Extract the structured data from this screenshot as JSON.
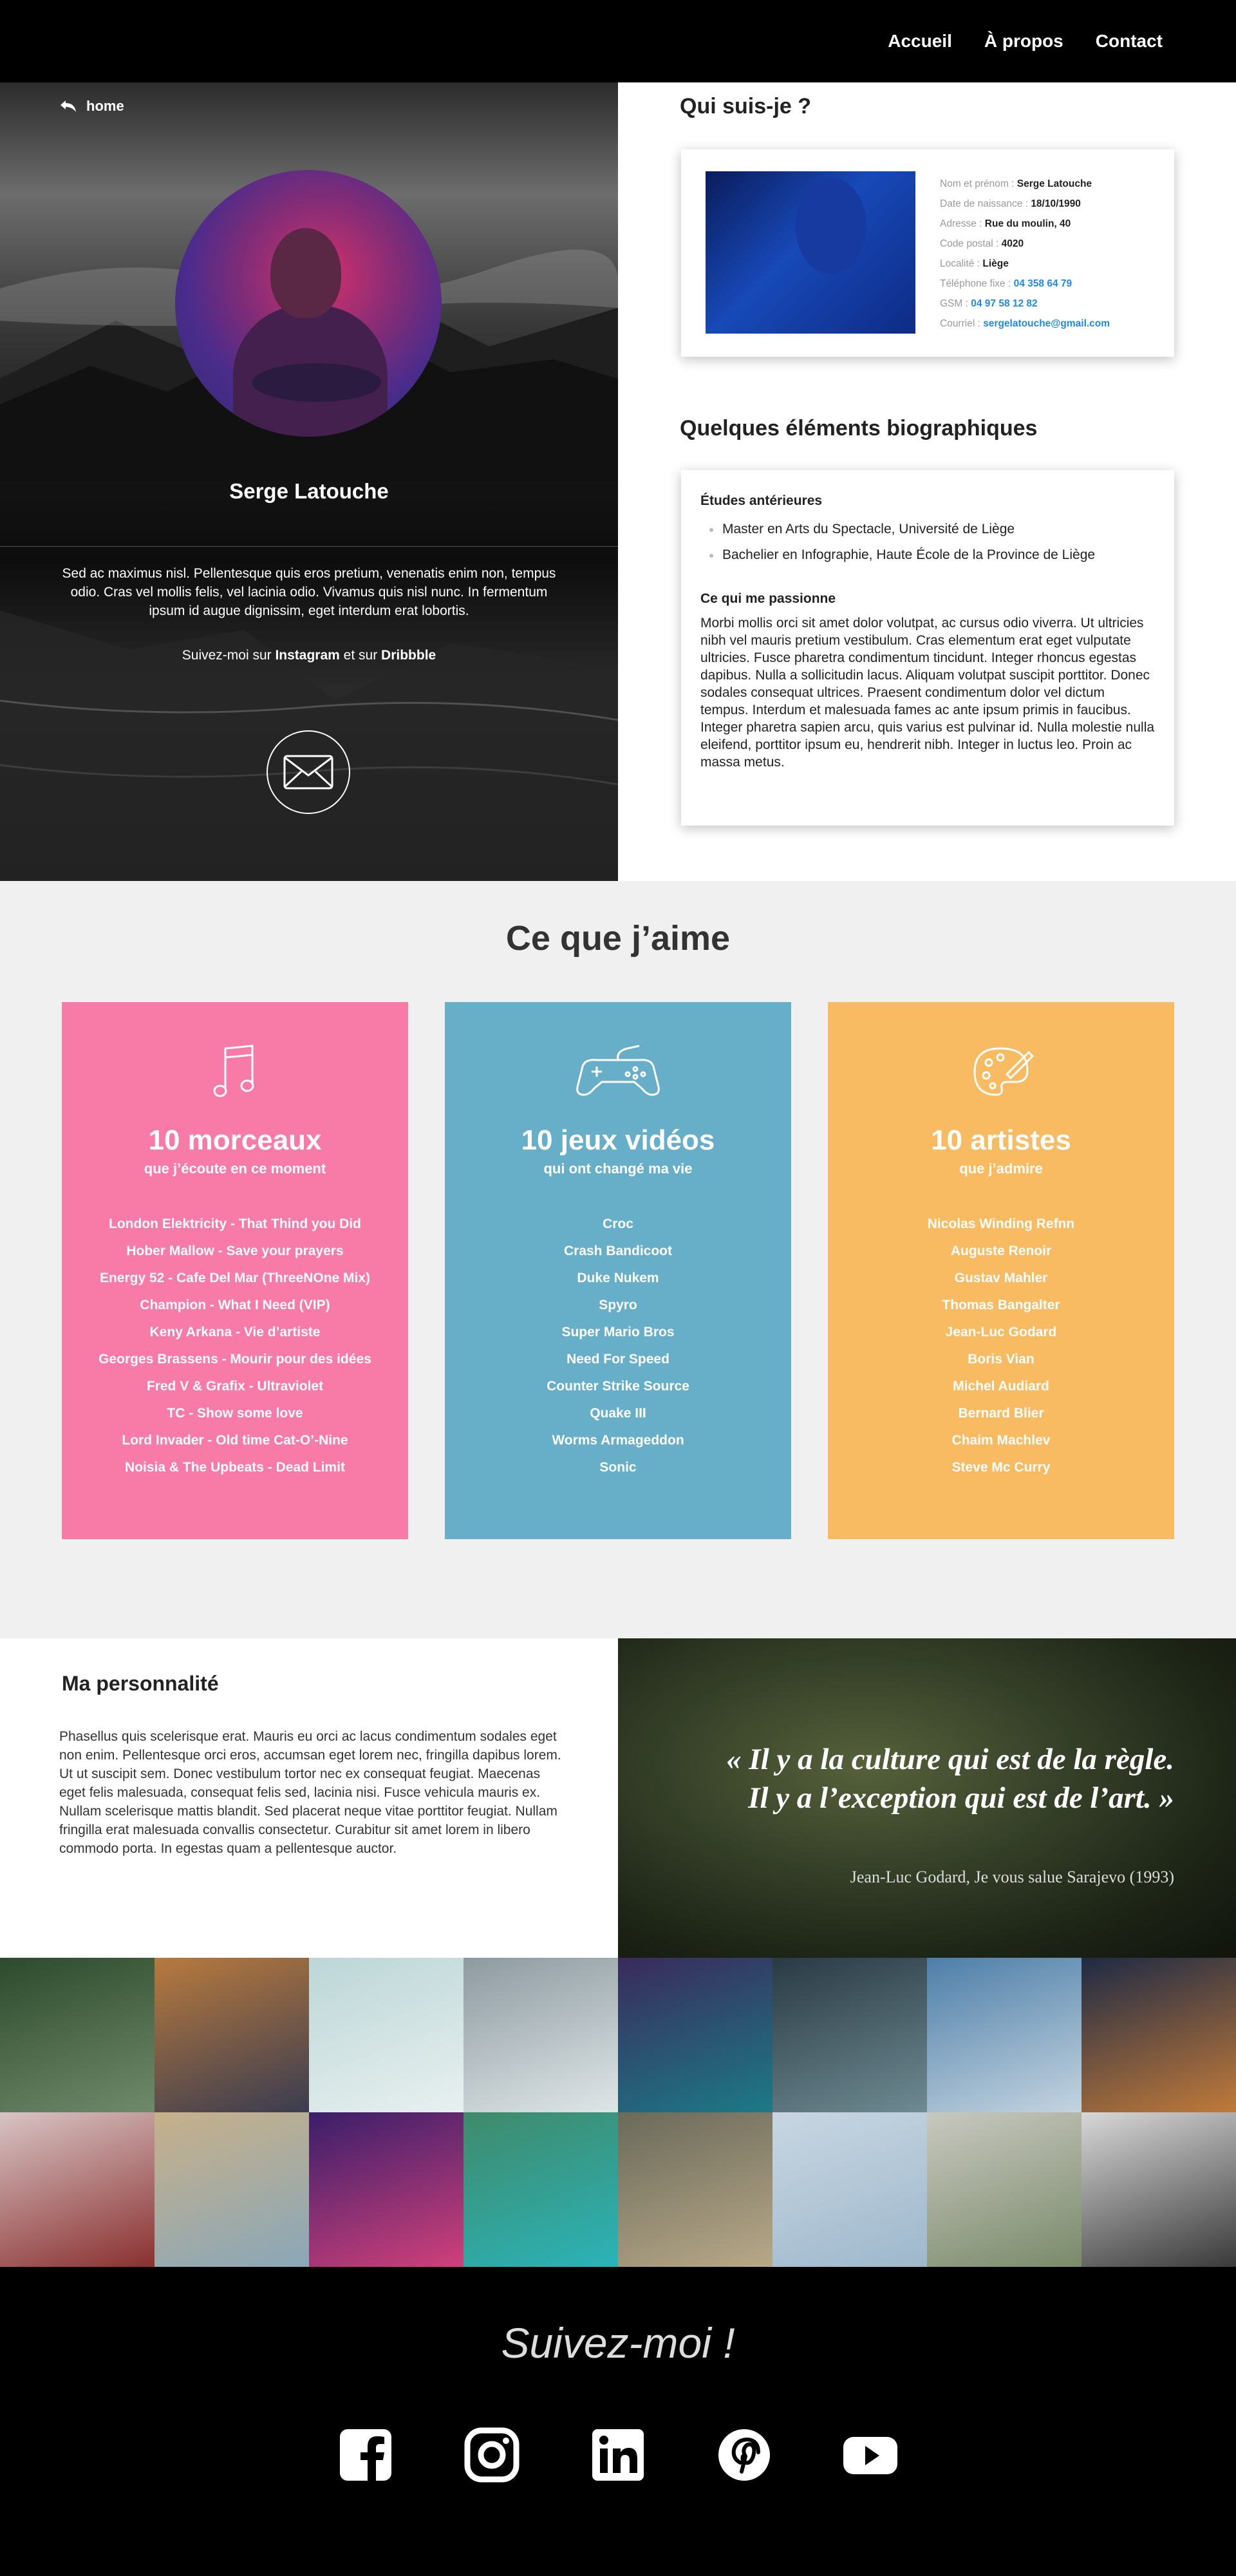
{
  "nav": {
    "items": [
      "Accueil",
      "À propos",
      "Contact"
    ]
  },
  "hero": {
    "back_label": "home",
    "name": "Serge Latouche",
    "bio": "Sed ac maximus nisl. Pellentesque quis eros pretium, venenatis enim non, tempus odio. Cras vel mollis felis, vel lacinia odio. Vivamus quis nisl nunc. In fermentum ipsum id augue dignissim, eget interdum erat lobortis.",
    "follow_prefix": "Suivez-moi sur ",
    "follow_instagram": "Instagram",
    "follow_mid": " et sur ",
    "follow_dribbble": "Dribbble",
    "mail_icon": "envelope-icon"
  },
  "about": {
    "title": "Qui suis-je ?",
    "fields": [
      {
        "label": "Nom et prénom : ",
        "value": "Serge Latouche",
        "link": false
      },
      {
        "label": "Date de naissance : ",
        "value": "18/10/1990",
        "link": false
      },
      {
        "label": "Adresse : ",
        "value": "Rue du moulin, 40",
        "link": false
      },
      {
        "label": "Code postal : ",
        "value": "4020",
        "link": false
      },
      {
        "label": "Localité : ",
        "value": "Liège",
        "link": false
      },
      {
        "label": "Téléphone fixe : ",
        "value": "04 358 64 79",
        "link": true
      },
      {
        "label": "GSM : ",
        "value": "04 97 58 12 82",
        "link": true
      },
      {
        "label": "Courriel : ",
        "value": "sergelatouche@gmail.com",
        "link": true
      }
    ]
  },
  "bio": {
    "title": "Quelques éléments biographiques",
    "studies_title": "Études antérieures",
    "studies": [
      "Master en Arts du Spectacle, Université de Liège",
      "Bachelier en Infographie, Haute École de la Province de Liège"
    ],
    "passion_title": "Ce qui me passionne",
    "passion_text": "Morbi mollis orci sit amet dolor volutpat, ac cursus odio viverra. Ut ultricies nibh vel mauris pretium vestibulum. Cras elementum erat eget vulputate ultricies. Fusce pharetra condimentum tincidunt. Integer rhoncus egestas dapibus. Nulla a sollicitudin lacus. Aliquam volutpat suscipit porttitor. Donec sodales consequat ultrices. Praesent condimentum dolor vel dictum tempus. Interdum et malesuada fames ac ante ipsum primis in faucibus. Integer pharetra sapien arcu, quis varius est pulvinar id. Nulla molestie nulla eleifend, porttitor ipsum eu, hendrerit nibh. Integer in luctus leo. Proin ac massa metus."
  },
  "likes": {
    "title": "Ce que j’aime",
    "cards": [
      {
        "icon": "music-note-icon",
        "color": "#f87aa6",
        "title": "10 morceaux",
        "subtitle": "que j’écoute en ce moment",
        "items": [
          "London Elektricity - That Thind you Did",
          "Hober Mallow - Save your prayers",
          "Energy 52 - Cafe Del Mar (ThreeNOne Mix)",
          "Champion - What I Need (VIP)",
          "Keny Arkana - Vie d’artiste",
          "Georges Brassens - Mourir pour des idées",
          "Fred V & Grafix - Ultraviolet",
          "TC - Show some love",
          "Lord Invader - Old time Cat-O’-Nine",
          "Noisia & The Upbeats - Dead Limit"
        ]
      },
      {
        "icon": "gamepad-icon",
        "color": "#67afc8",
        "title": "10 jeux vidéos",
        "subtitle": "qui ont changé ma vie",
        "items": [
          "Croc",
          "Crash Bandicoot",
          "Duke Nukem",
          "Spyro",
          "Super Mario Bros",
          "Need For Speed",
          "Counter Strike Source",
          "Quake III",
          "Worms Armageddon",
          "Sonic"
        ]
      },
      {
        "icon": "palette-icon",
        "color": "#f8bb62",
        "title": "10 artistes",
        "subtitle": "que j’admire",
        "items": [
          "Nicolas Winding Refnn",
          "Auguste Renoir",
          "Gustav Mahler",
          "Thomas Bangalter",
          "Jean-Luc Godard",
          "Boris Vian",
          "Michel Audiard",
          "Bernard Blier",
          "Chaim Machlev",
          "Steve Mc Curry"
        ]
      }
    ]
  },
  "personality": {
    "title": "Ma personnalité",
    "text": "Phasellus quis scelerisque erat. Mauris eu orci ac lacus condimentum sodales eget non enim. Pellentesque orci eros, accumsan eget lorem nec, fringilla dapibus lorem. Ut ut suscipit sem. Donec vestibulum tortor nec ex consequat feugiat. Maecenas eget felis malesuada, consequat felis sed, lacinia nisi. Fusce vehicula mauris ex. Nullam scelerisque mattis blandit. Sed placerat neque vitae porttitor feugiat. Nullam fringilla erat malesuada convallis consectetur. Curabitur sit amet lorem in libero commodo porta. In egestas quam a pellentesque auctor."
  },
  "quote": {
    "line1": "« Il y a la culture qui est de la règle.",
    "line2": "Il y a l’exception qui est de l’art. »",
    "source": "Jean-Luc Godard, Je vous salue Sarajevo (1993)"
  },
  "gallery": {
    "photos": [
      "waterfall-photo",
      "city-skyline-photo",
      "tv-tower-photo",
      "wave-photo",
      "neon-street-photo",
      "metro-escalator-photo",
      "glass-hall-photo",
      "night-street-photo",
      "man-red-scarf-photo",
      "beach-photo",
      "neon-signs-photo",
      "tropical-island-photo",
      "coastline-aerial-photo",
      "building-facade-photo",
      "foggy-field-photo",
      "bearded-man-photo"
    ],
    "colors": [
      [
        "#2d4a2c",
        "#6f8a6a"
      ],
      [
        "#b87a3e",
        "#3a3c50"
      ],
      [
        "#bcd6d7",
        "#e8f0f0"
      ],
      [
        "#8d9aa0",
        "#dfe6e8"
      ],
      [
        "#3a2a5c",
        "#1c7a86"
      ],
      [
        "#2a3a44",
        "#6e8a92"
      ],
      [
        "#4d7ea8",
        "#c4d4e0"
      ],
      [
        "#1f2a44",
        "#c07a3a"
      ],
      [
        "#d8c4c4",
        "#8a3030"
      ],
      [
        "#c7b08a",
        "#8aa7b8"
      ],
      [
        "#3a1e6a",
        "#d0407a"
      ],
      [
        "#3f8a6a",
        "#2bb3b8"
      ],
      [
        "#6a6a5a",
        "#b8a888"
      ],
      [
        "#c8d6e2",
        "#9eb8cc"
      ],
      [
        "#c8c8c0",
        "#7a8a6a"
      ],
      [
        "#d8d8d8",
        "#3a3a3a"
      ]
    ]
  },
  "footer": {
    "title": "Suivez-moi !",
    "icons": [
      "facebook-icon",
      "instagram-icon",
      "linkedin-icon",
      "pinterest-icon",
      "youtube-icon"
    ]
  }
}
